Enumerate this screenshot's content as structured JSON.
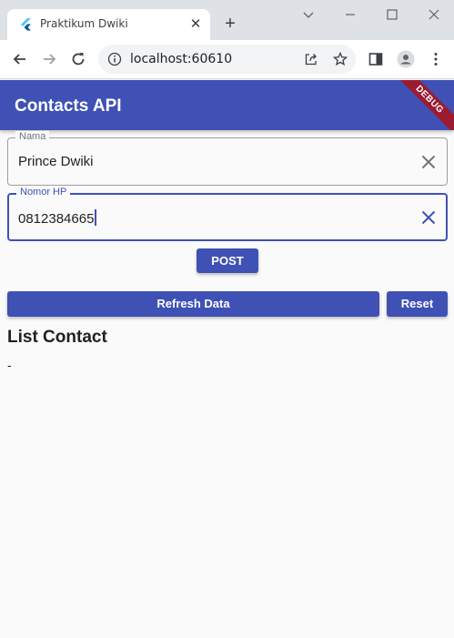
{
  "browser": {
    "tab_title": "Praktikum Dwiki",
    "url": "localhost:60610"
  },
  "appbar": {
    "title": "Contacts API",
    "debug_banner": "DEBUG"
  },
  "form": {
    "nama": {
      "label": "Nama",
      "value": "Prince Dwiki"
    },
    "hp": {
      "label": "Nomor HP",
      "value": "0812384665"
    },
    "post_label": "POST"
  },
  "actions": {
    "refresh_label": "Refresh Data",
    "reset_label": "Reset"
  },
  "list": {
    "title": "List Contact",
    "empty_text": "-"
  },
  "colors": {
    "primary": "#3f51b5",
    "debug": "#9b1b30"
  }
}
